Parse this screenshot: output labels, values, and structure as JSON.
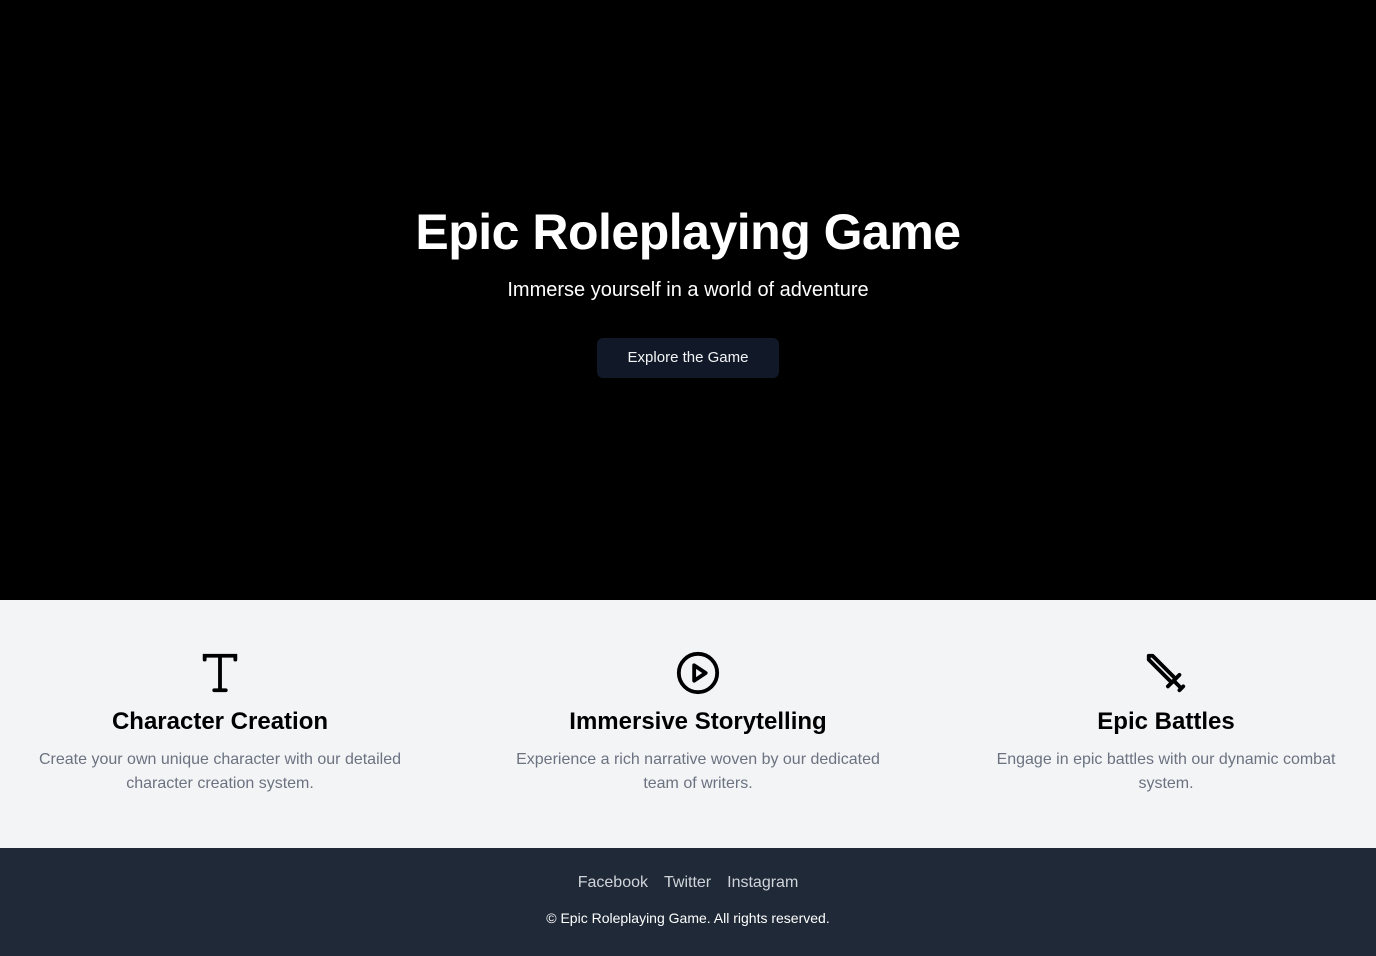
{
  "hero": {
    "title": "Epic Roleplaying Game",
    "subtitle": "Immerse yourself in a world of adventure",
    "cta": "Explore the Game"
  },
  "features": [
    {
      "icon": "type-icon",
      "title": "Character Creation",
      "desc": "Create your own unique character with our detailed character creation system."
    },
    {
      "icon": "play-circle-icon",
      "title": "Immersive Storytelling",
      "desc": "Experience a rich narrative woven by our dedicated team of writers."
    },
    {
      "icon": "sword-icon",
      "title": "Epic Battles",
      "desc": "Engage in epic battles with our dynamic combat system."
    }
  ],
  "footer": {
    "links": [
      "Facebook",
      "Twitter",
      "Instagram"
    ],
    "copyright": "© Epic Roleplaying Game. All rights reserved."
  },
  "colors": {
    "hero_bg": "#000000",
    "button_bg": "#111827",
    "features_bg": "#f3f4f6",
    "footer_bg": "#1f2937"
  }
}
